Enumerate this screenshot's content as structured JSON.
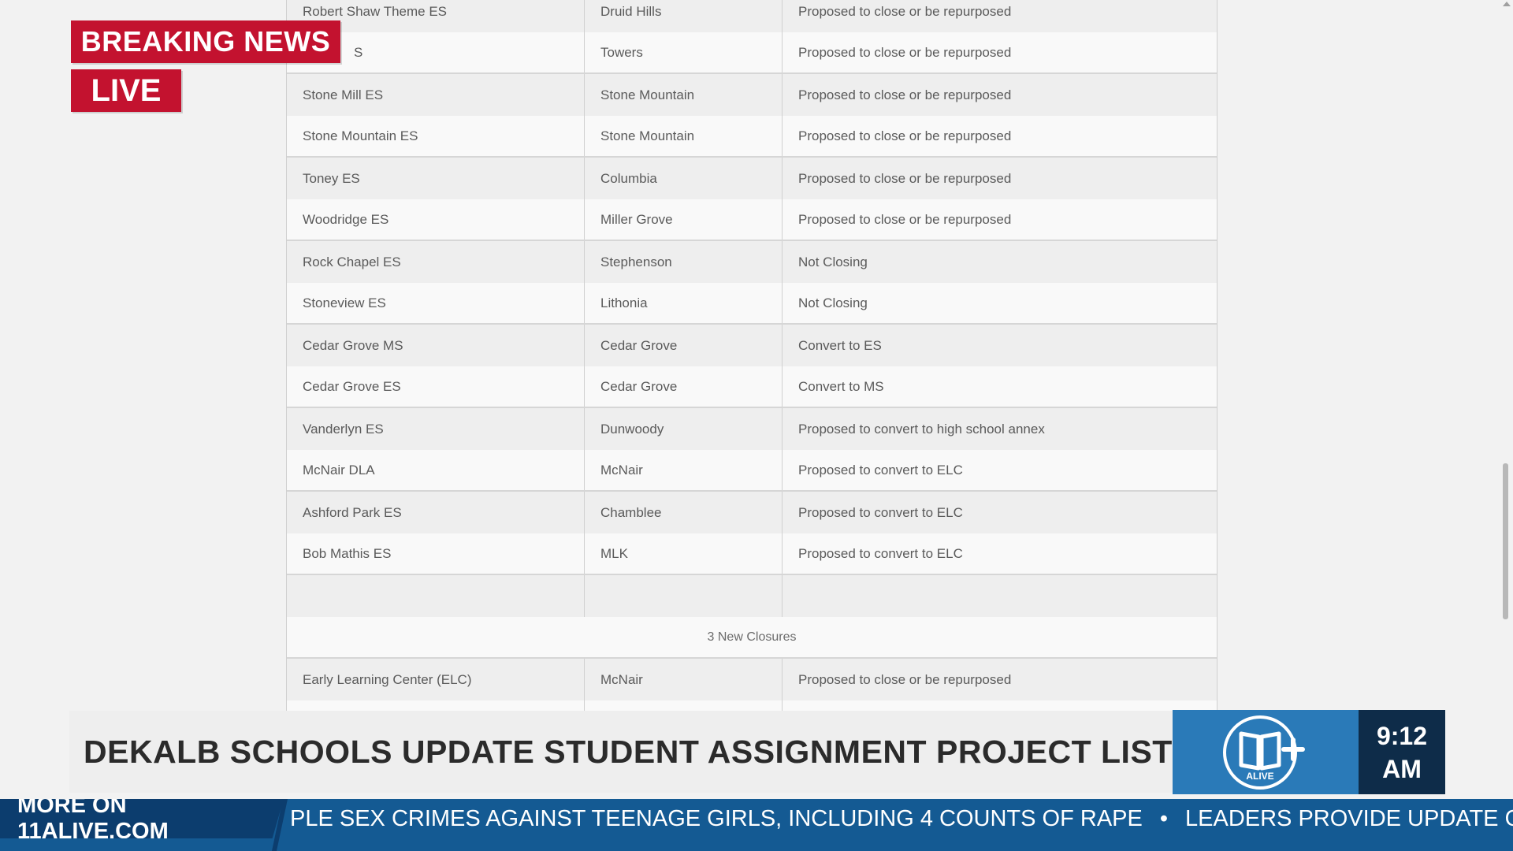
{
  "overlay": {
    "breaking_label": "BREAKING NEWS",
    "live_label": "LIVE"
  },
  "table": {
    "rows": [
      {
        "school": "Robert Shaw Theme ES",
        "region": "Druid Hills",
        "status": "Proposed to close or be repurposed"
      },
      {
        "school": "S",
        "region": "Towers",
        "status": "Proposed to close or be repurposed"
      },
      {
        "school": "Stone Mill ES",
        "region": "Stone Mountain",
        "status": "Proposed to close or be repurposed"
      },
      {
        "school": "Stone Mountain ES",
        "region": "Stone Mountain",
        "status": "Proposed to close or be repurposed"
      },
      {
        "school": "Toney ES",
        "region": "Columbia",
        "status": "Proposed to close or be repurposed"
      },
      {
        "school": "Woodridge ES",
        "region": "Miller Grove",
        "status": "Proposed to close or be repurposed"
      },
      {
        "school": "Rock Chapel ES",
        "region": "Stephenson",
        "status": "Not Closing"
      },
      {
        "school": "Stoneview ES",
        "region": "Lithonia",
        "status": "Not Closing"
      },
      {
        "school": "Cedar Grove MS",
        "region": "Cedar Grove",
        "status": "Convert to ES"
      },
      {
        "school": "Cedar Grove ES",
        "region": "Cedar Grove",
        "status": "Convert to MS"
      },
      {
        "school": "Vanderlyn ES",
        "region": "Dunwoody",
        "status": "Proposed to convert to high school annex"
      },
      {
        "school": "McNair DLA",
        "region": "McNair",
        "status": "Proposed to convert to ELC"
      },
      {
        "school": "Ashford Park ES",
        "region": "Chamblee",
        "status": "Proposed to convert to ELC"
      },
      {
        "school": "Bob Mathis ES",
        "region": "MLK",
        "status": "Proposed to convert to ELC"
      },
      {
        "school": "",
        "region": "",
        "status": ""
      }
    ],
    "section_header": "3 New Closures",
    "after_rows": [
      {
        "school": "Early Learning Center (ELC)",
        "region": "McNair",
        "status": "Proposed to close or be repurposed"
      }
    ]
  },
  "lower_third": {
    "headline": "DEKALB SCHOOLS UPDATE STUDENT ASSIGNMENT PROJECT LIST",
    "logo_text": "ALIVE",
    "time": "9:12",
    "ampm": "AM"
  },
  "ticker": {
    "label": "MORE ON 11ALIVE.COM",
    "items": [
      "PLE SEX CRIMES AGAINST TEENAGE GIRLS, INCLUDING 4 COUNTS OF RAPE",
      "LEADERS PROVIDE UPDATE ON S"
    ]
  },
  "colors": {
    "breaking_red": "#c3122f",
    "ticker_blue": "#145a93",
    "logo_blue": "#2a7ab8",
    "clock_navy": "#0e2c49"
  }
}
